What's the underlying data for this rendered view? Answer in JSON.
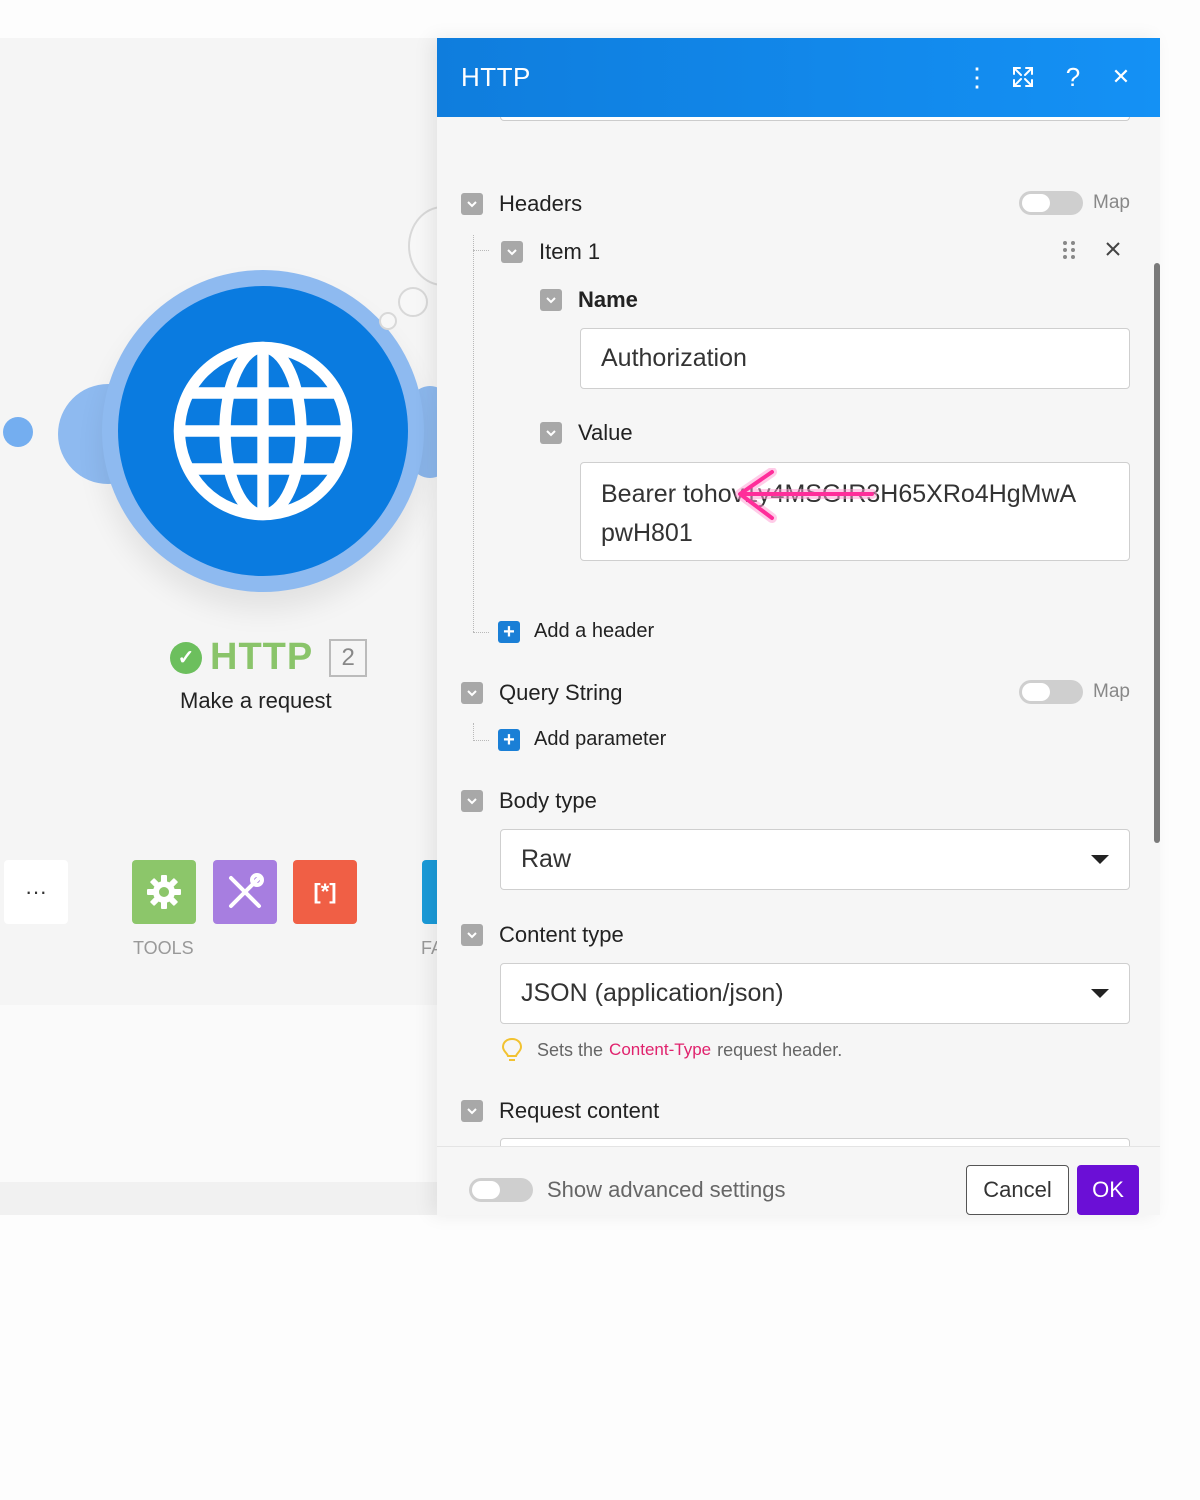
{
  "canvas": {
    "module": {
      "name": "HTTP",
      "badge": "2",
      "subtitle": "Make a request",
      "icon": "globe-icon"
    },
    "toolbar": {
      "more": "···",
      "tools_label": "TOOLS",
      "cut_label": "FA",
      "colors": {
        "tools": "#8cc66a",
        "tools2": "#a77ee0",
        "tools3": "#f05f45",
        "flow": "#1a9ad8"
      }
    }
  },
  "panel": {
    "title": "HTTP",
    "header_icons": [
      "more-vertical-icon",
      "expand-icon",
      "help-icon",
      "close-icon"
    ],
    "help_glyph": "?",
    "close_glyph": "✕",
    "more_glyph": "⋮",
    "headers": {
      "label": "Headers",
      "map_label": "Map",
      "item": {
        "label": "Item 1",
        "name_label": "Name",
        "name_value": "Authorization",
        "value_label": "Value",
        "value_line1": "Bearer tohov1y4MSGIR3H65XRo4HgMwA",
        "value_line2": "pwH801"
      },
      "add_label": "Add a header"
    },
    "query_string": {
      "label": "Query String",
      "map_label": "Map",
      "add_label": "Add parameter"
    },
    "body_type": {
      "label": "Body type",
      "selected": "Raw"
    },
    "content_type": {
      "label": "Content type",
      "selected": "JSON (application/json)",
      "hint_before": "Sets the",
      "hint_code": "Content-Type",
      "hint_after": "request header."
    },
    "request_content": {
      "label": "Request content",
      "value": "{"
    },
    "footer": {
      "advanced_label": "Show advanced settings",
      "cancel_label": "Cancel",
      "ok_label": "OK"
    }
  },
  "colors": {
    "header_blue": "#1491f5",
    "ok_purple": "#6b0fd6",
    "arrow_pink": "#ff2d9a",
    "success_green": "#6cbf5d"
  }
}
